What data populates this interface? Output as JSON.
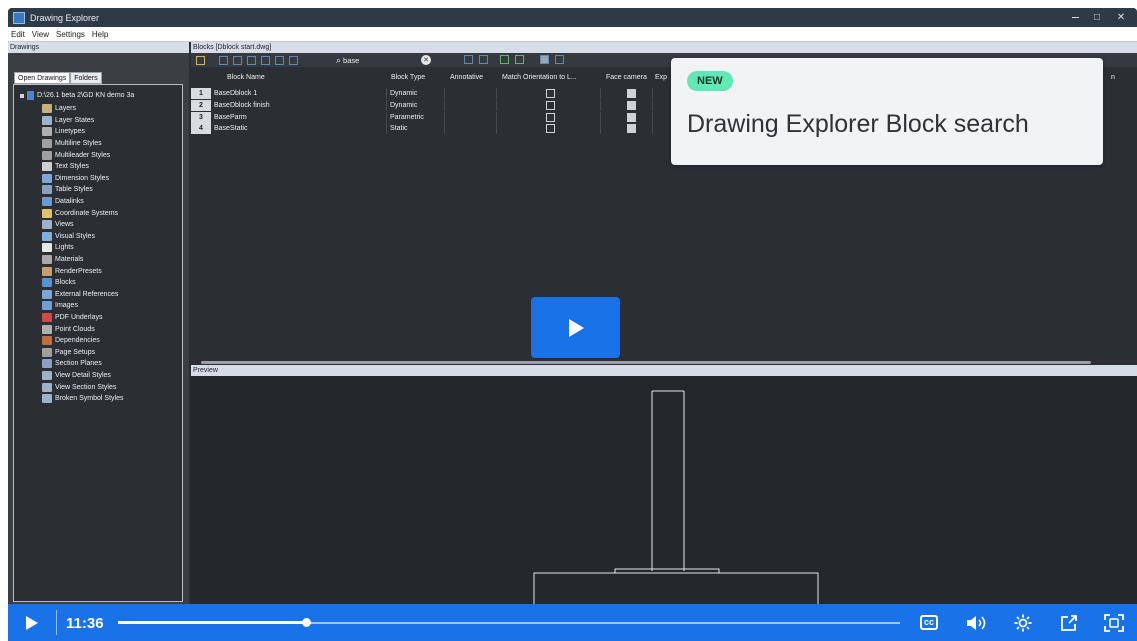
{
  "window": {
    "title": "Drawing Explorer",
    "min_icon": "minimize-icon",
    "max_label": "□",
    "close_label": "✕"
  },
  "menu": [
    "Edit",
    "View",
    "Settings",
    "Help"
  ],
  "drawings_panel": {
    "header": "Drawings",
    "tabs": [
      "Open Drawings",
      "Folders"
    ],
    "root": "D:\\26.1 beta 2\\GD KN demo 3a",
    "items": [
      {
        "label": "Layers",
        "icon": "layers-icon",
        "color": "#c9b27a"
      },
      {
        "label": "Layer States",
        "icon": "layer-states-icon",
        "color": "#9fb3c8"
      },
      {
        "label": "Linetypes",
        "icon": "linetypes-icon",
        "color": "#b0b0b0"
      },
      {
        "label": "Multiline Styles",
        "icon": "multiline-styles-icon",
        "color": "#a0a0a0"
      },
      {
        "label": "Multileader Styles",
        "icon": "multileader-styles-icon",
        "color": "#a0a0a0"
      },
      {
        "label": "Text Styles",
        "icon": "text-styles-icon",
        "color": "#cfcfcf"
      },
      {
        "label": "Dimension Styles",
        "icon": "dimension-styles-icon",
        "color": "#7fa6d6"
      },
      {
        "label": "Table Styles",
        "icon": "table-styles-icon",
        "color": "#8aa1bd"
      },
      {
        "label": "Datalinks",
        "icon": "datalinks-icon",
        "color": "#6f9ad0"
      },
      {
        "label": "Coordinate Systems",
        "icon": "coordinate-systems-icon",
        "color": "#e0c070"
      },
      {
        "label": "Views",
        "icon": "views-icon",
        "color": "#9fb3c8"
      },
      {
        "label": "Visual Styles",
        "icon": "visual-styles-icon",
        "color": "#7fb0e0"
      },
      {
        "label": "Lights",
        "icon": "lights-icon",
        "color": "#e8e8e8"
      },
      {
        "label": "Materials",
        "icon": "materials-icon",
        "color": "#a8a8a8"
      },
      {
        "label": "RenderPresets",
        "icon": "render-presets-icon",
        "color": "#c8a070"
      },
      {
        "label": "Blocks",
        "icon": "blocks-icon",
        "color": "#5a8fd0"
      },
      {
        "label": "External References",
        "icon": "external-references-icon",
        "color": "#7fa6d6"
      },
      {
        "label": "Images",
        "icon": "images-icon",
        "color": "#6fa0d8"
      },
      {
        "label": "PDF Underlays",
        "icon": "pdf-underlays-icon",
        "color": "#d04a4a"
      },
      {
        "label": "Point Clouds",
        "icon": "point-clouds-icon",
        "color": "#b0b0b0"
      },
      {
        "label": "Dependencies",
        "icon": "dependencies-icon",
        "color": "#c07040"
      },
      {
        "label": "Page Setups",
        "icon": "page-setups-icon",
        "color": "#a0a0a0"
      },
      {
        "label": "Section Planes",
        "icon": "section-planes-icon",
        "color": "#8aa1bd"
      },
      {
        "label": "View Detail Styles",
        "icon": "view-detail-styles-icon",
        "color": "#9fb3c8"
      },
      {
        "label": "View Section Styles",
        "icon": "view-section-styles-icon",
        "color": "#9fb3c8"
      },
      {
        "label": "Broken Symbol Styles",
        "icon": "broken-symbol-styles-icon",
        "color": "#9fb3c8"
      }
    ]
  },
  "blocks_panel": {
    "header": "Blocks [Dblock start.dwg]",
    "search": {
      "value": "base",
      "icon": "search-icon",
      "clear_icon": "clear-search-icon",
      "clear_glyph": "✕"
    },
    "columns": [
      "Block Name",
      "Block Type",
      "Annotative",
      "Match Orientation to L...",
      "Face camera",
      "Exp",
      "n"
    ],
    "rows": [
      {
        "num": "1",
        "name": "BaseDblock 1",
        "type": "Dynamic",
        "match": false,
        "face": true
      },
      {
        "num": "2",
        "name": "BaseDblock finish",
        "type": "Dynamic",
        "match": false,
        "face": true
      },
      {
        "num": "3",
        "name": "BaseParm",
        "type": "Parametric",
        "match": false,
        "face": true
      },
      {
        "num": "4",
        "name": "BaseStatic",
        "type": "Static",
        "match": false,
        "face": true
      }
    ]
  },
  "announcement": {
    "badge": "NEW",
    "title": "Drawing Explorer Block search",
    "badge_color": "#61e8b4"
  },
  "preview_panel": {
    "header": "Preview"
  },
  "video": {
    "time": "11:36",
    "progress_fraction": 0.24,
    "accent": "#1a72e8",
    "cc_label": "cc"
  }
}
